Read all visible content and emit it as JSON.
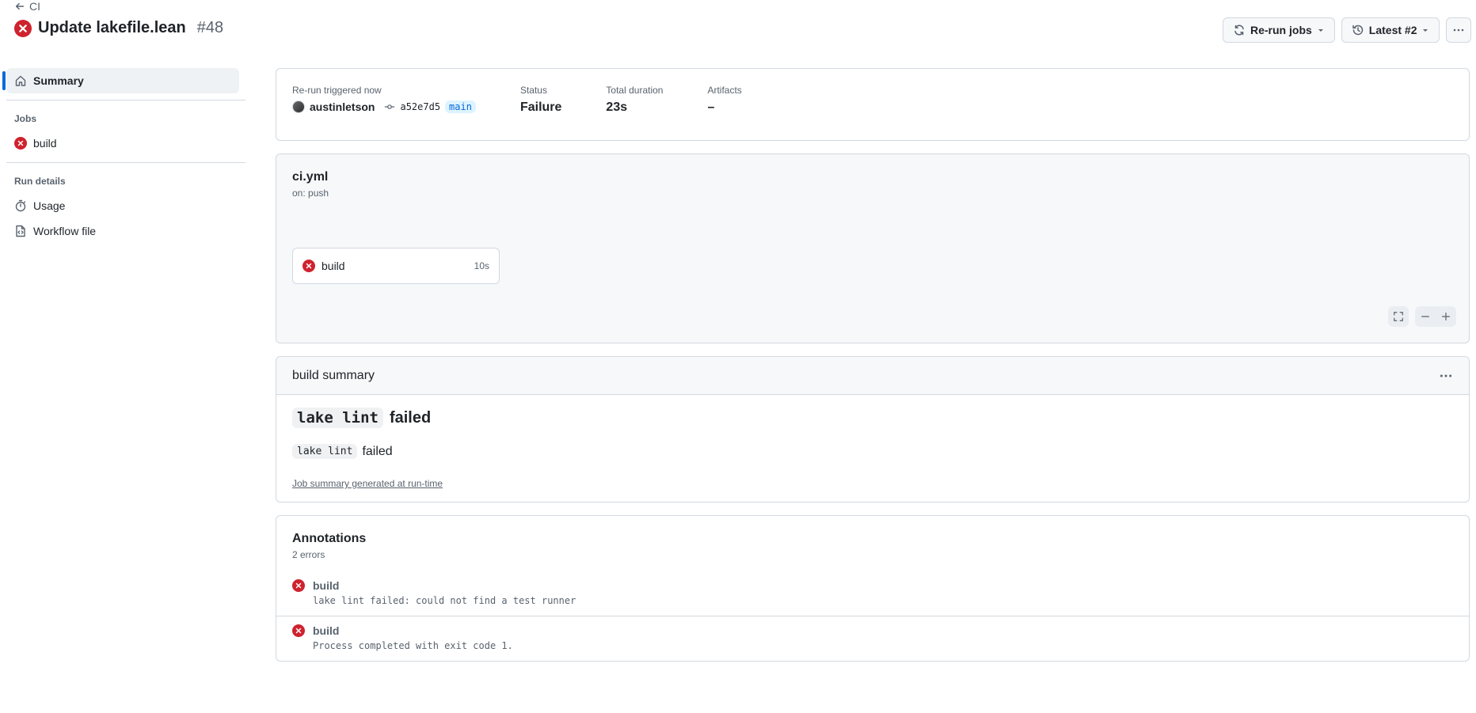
{
  "header": {
    "back_label": "CI",
    "title": "Update lakefile.lean",
    "run_number": "#48",
    "rerun_label": "Re-run jobs",
    "attempt_label": "Latest #2"
  },
  "sidebar": {
    "summary_label": "Summary",
    "jobs_heading": "Jobs",
    "jobs": [
      {
        "label": "build"
      }
    ],
    "run_details_heading": "Run details",
    "usage_label": "Usage",
    "workflow_file_label": "Workflow file"
  },
  "run": {
    "trigger_label": "Re-run triggered now",
    "author": "austinletson",
    "commit_sha": "a52e7d5",
    "branch": "main",
    "status_label": "Status",
    "status_value": "Failure",
    "duration_label": "Total duration",
    "duration_value": "23s",
    "artifacts_label": "Artifacts",
    "artifacts_value": "–"
  },
  "graph": {
    "workflow_file": "ci.yml",
    "trigger": "on: push",
    "job_name": "build",
    "job_duration": "10s"
  },
  "summary": {
    "header": "build summary",
    "heading_code": "lake lint",
    "heading_text": "failed",
    "para_code": "lake lint",
    "para_text": "failed",
    "footer_link": "Job summary generated at run-time"
  },
  "annotations": {
    "title": "Annotations",
    "count": "2 errors",
    "items": [
      {
        "title": "build",
        "message": "lake lint failed: could not find a test runner"
      },
      {
        "title": "build",
        "message": "Process completed with exit code 1."
      }
    ]
  },
  "colors": {
    "danger": "#cf222e",
    "accent": "#0969da"
  }
}
